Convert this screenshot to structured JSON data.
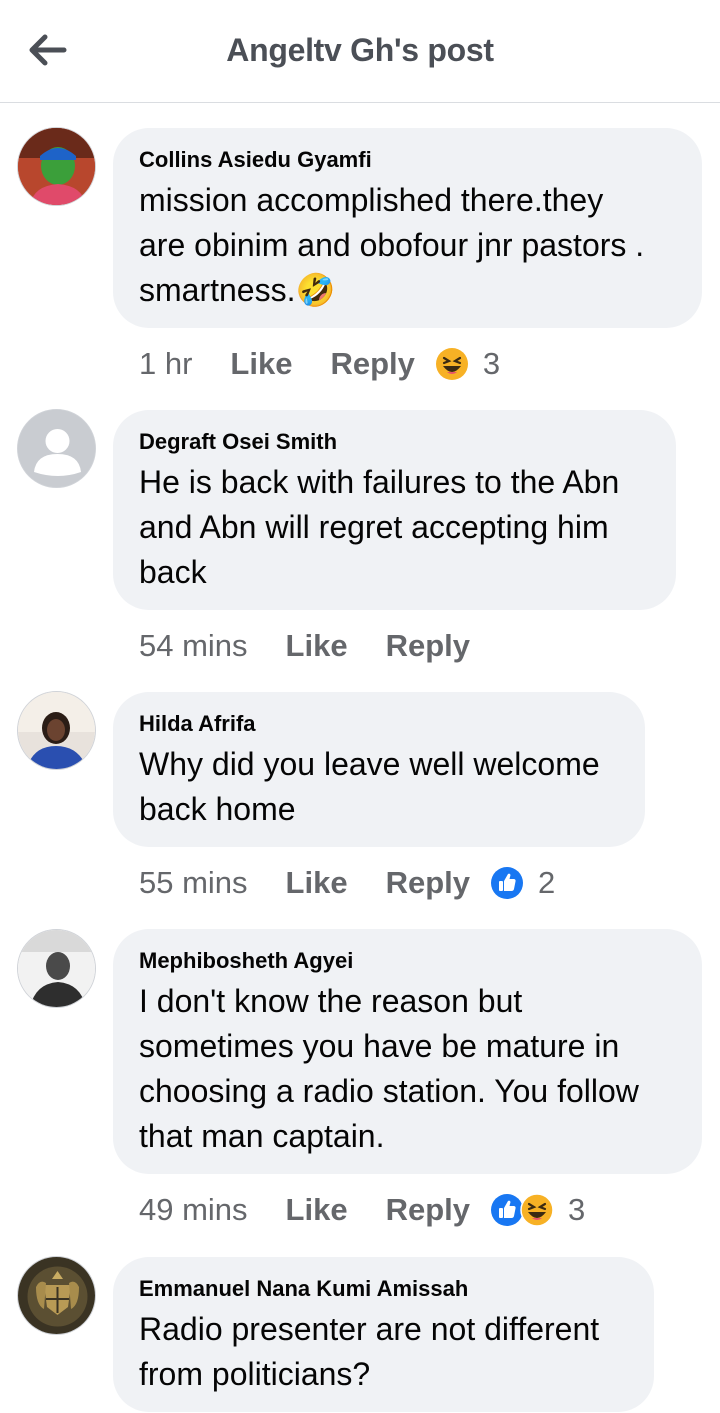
{
  "header": {
    "title": "Angeltv Gh's post"
  },
  "comments": [
    {
      "author": "Collins Asiedu Gyamfi",
      "lines": [
        "mission accomplished there.they",
        "are obinim and obofour jnr pastors .",
        "smartness.🤣"
      ],
      "time": "1 hr",
      "like_label": "Like",
      "reply_label": "Reply",
      "reactions": [
        "haha"
      ],
      "reaction_count": "3"
    },
    {
      "author": "Degraft Osei Smith",
      "lines": [
        "He is back with failures to the Abn",
        "and Abn will regret accepting him",
        "back"
      ],
      "time": "54 mins",
      "like_label": "Like",
      "reply_label": "Reply",
      "reactions": [],
      "reaction_count": ""
    },
    {
      "author": "Hilda Afrifa",
      "lines": [
        "Why did you leave well welcome",
        "back home"
      ],
      "time": "55 mins",
      "like_label": "Like",
      "reply_label": "Reply",
      "reactions": [
        "like"
      ],
      "reaction_count": "2"
    },
    {
      "author": "Mephibosheth Agyei",
      "lines": [
        "I don't know the reason but",
        "sometimes you have be mature in",
        "choosing a radio station. You follow",
        "that man captain."
      ],
      "time": "49 mins",
      "like_label": "Like",
      "reply_label": "Reply",
      "reactions": [
        "like",
        "haha"
      ],
      "reaction_count": "3"
    },
    {
      "author": "Emmanuel Nana Kumi Amissah",
      "lines": [
        "Radio presenter are not different",
        "from politicians?"
      ],
      "time": "",
      "like_label": "",
      "reply_label": "",
      "reactions": [],
      "reaction_count": ""
    }
  ],
  "colors": {
    "like_blue": "#1877f2",
    "haha_yellow": "#f7b125",
    "bubble_bg": "#f0f2f5",
    "meta_gray": "#65676b"
  }
}
